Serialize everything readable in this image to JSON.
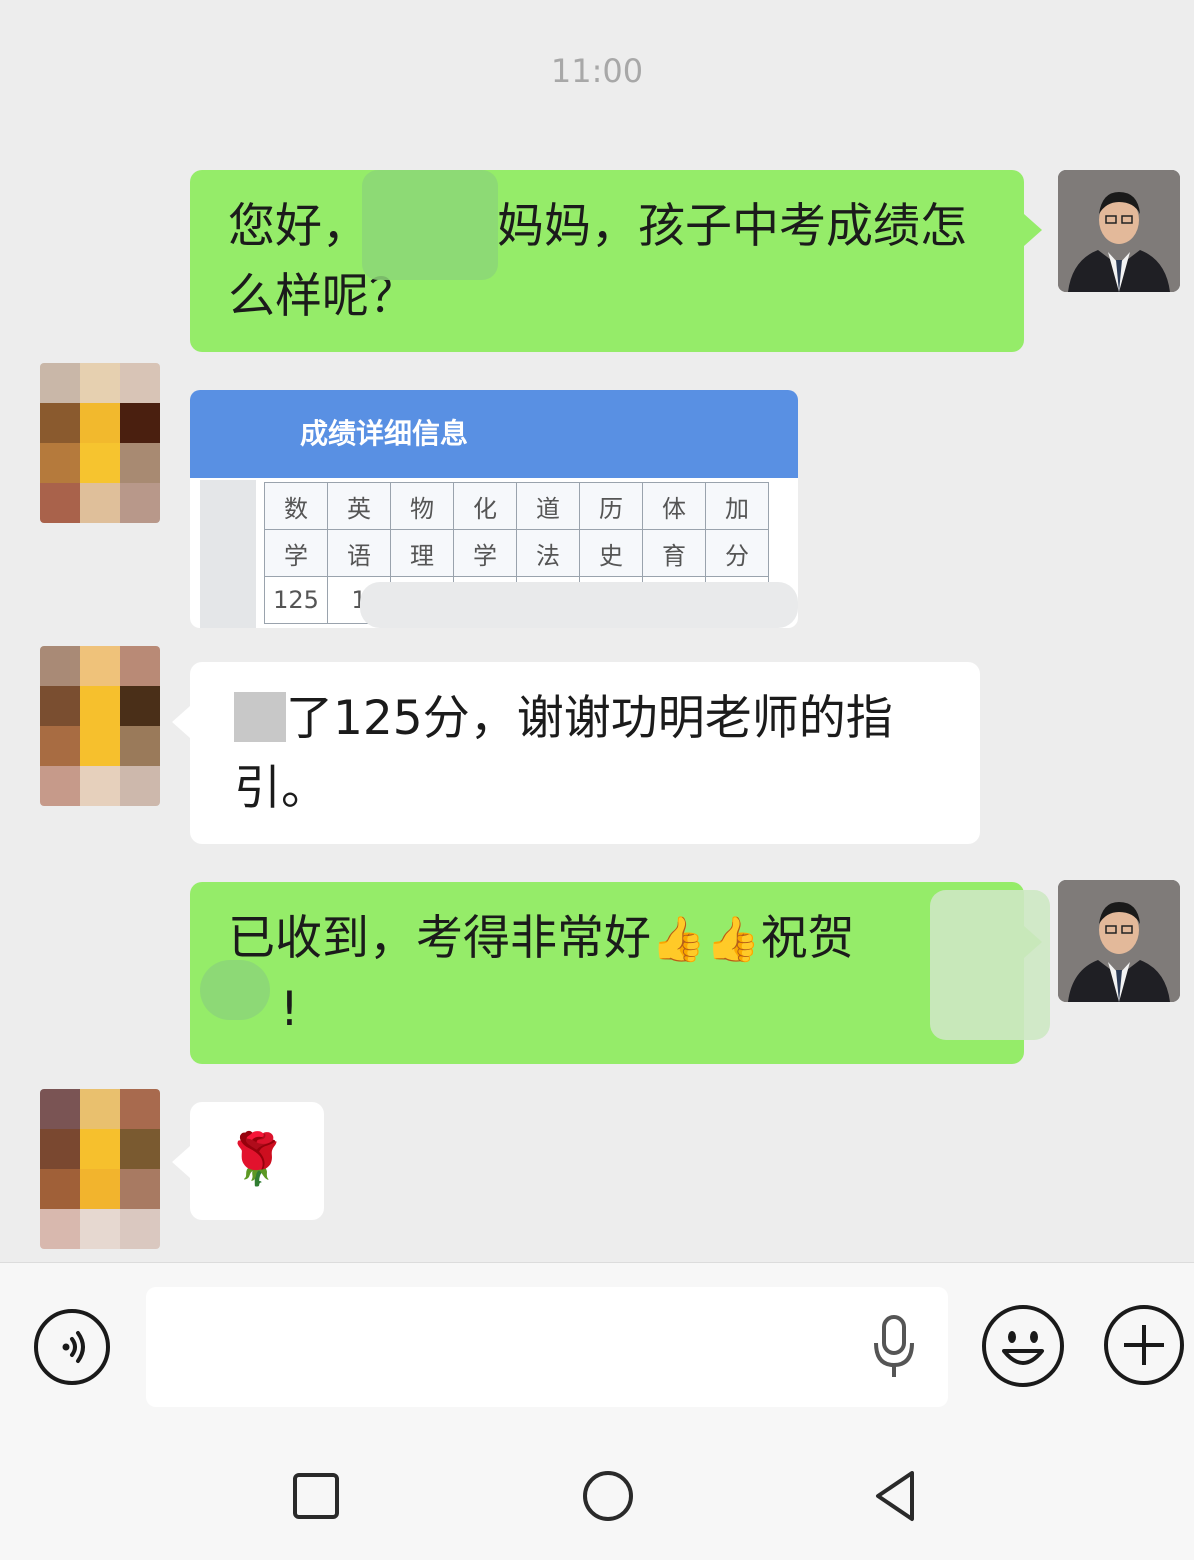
{
  "status": {
    "time": "11:00"
  },
  "messages": [
    {
      "side": "out",
      "text_line1_a": "您好，",
      "text_line1_b": "妈妈，孩子中考成绩怎",
      "text_line2": "么样呢？"
    },
    {
      "side": "in",
      "type": "image",
      "card_title": "成绩详细信息",
      "subjects_top": [
        "数",
        "英",
        "物",
        "化",
        "道",
        "历",
        "体",
        "加"
      ],
      "subjects_bottom": [
        "学",
        "语",
        "理",
        "学",
        "法",
        "史",
        "育",
        "分"
      ],
      "scores": [
        "125",
        "1"
      ]
    },
    {
      "side": "in",
      "text_line1": "了125分，谢谢功明老师的指",
      "text_line2": "引。"
    },
    {
      "side": "out",
      "text_line1_a": "已收到，考得非常好",
      "emoji": "👍👍",
      "text_line1_b": "祝贺",
      "text_line2": "!"
    },
    {
      "side": "in",
      "emoji": "🌹"
    }
  ],
  "icons": {
    "voice": "voice-icon",
    "mic": "microphone-icon",
    "emoji": "emoji-icon",
    "plus": "plus-icon",
    "nav_recent": "square-icon",
    "nav_home": "circle-icon",
    "nav_back": "triangle-back-icon"
  },
  "colors": {
    "outgoing": "#95ec69",
    "incoming": "#ffffff",
    "background": "#ededed",
    "card_header": "#5990e3"
  }
}
